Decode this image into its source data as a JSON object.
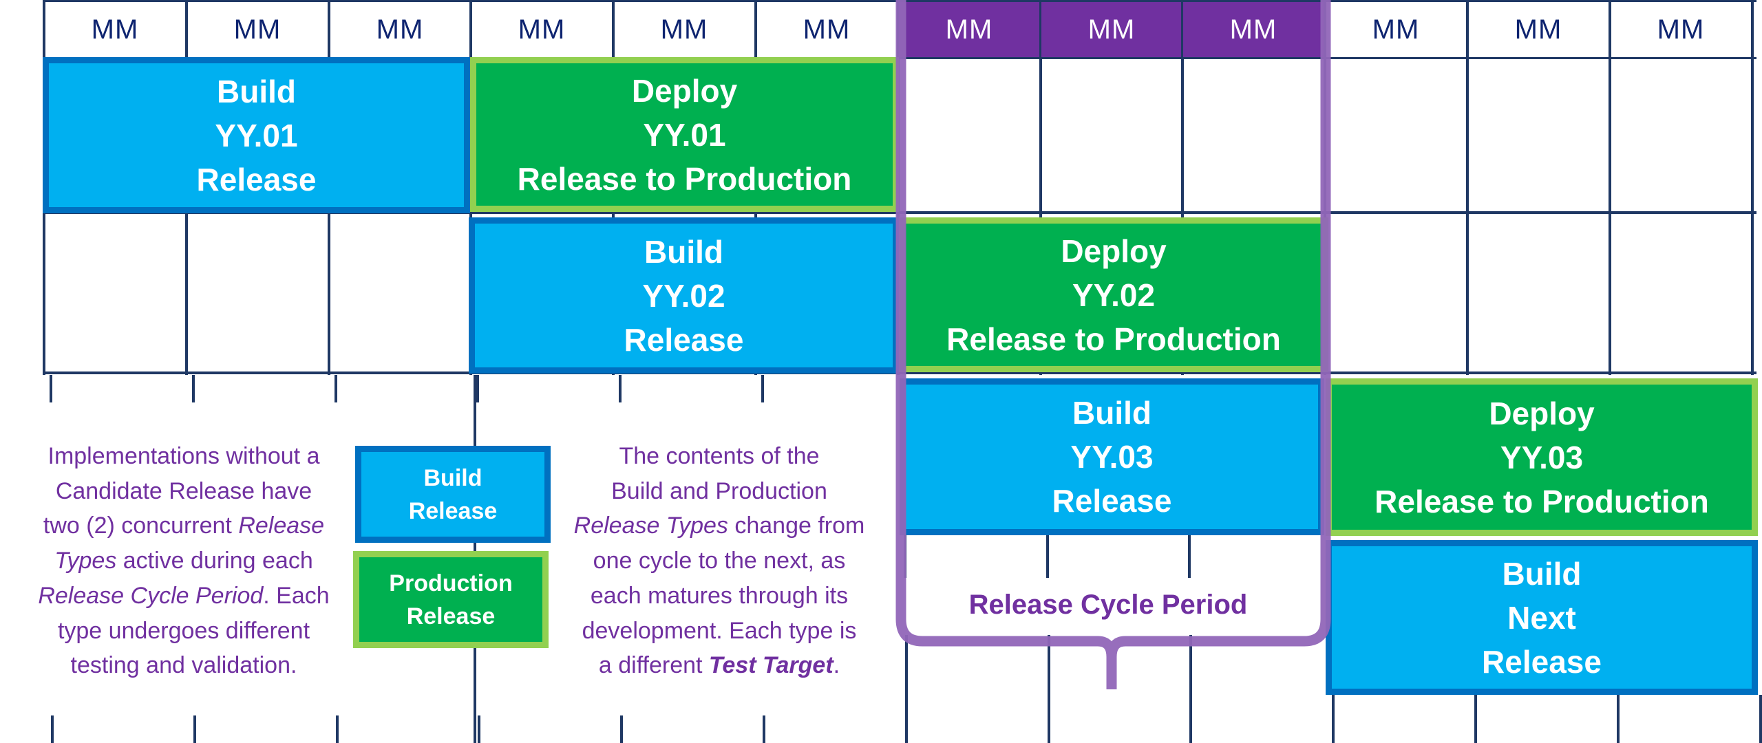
{
  "timeline": {
    "month_headers": [
      "MM",
      "MM",
      "MM",
      "MM",
      "MM",
      "MM",
      "MM",
      "MM",
      "MM",
      "MM",
      "MM",
      "MM"
    ],
    "highlighted_months": [
      6,
      7,
      8
    ]
  },
  "bars": [
    {
      "type": "build",
      "lines": [
        "Build",
        "YY.01",
        "Release"
      ]
    },
    {
      "type": "deploy",
      "lines": [
        "Deploy",
        "YY.01",
        "Release to Production"
      ]
    },
    {
      "type": "build",
      "lines": [
        "Build",
        "YY.02",
        "Release"
      ]
    },
    {
      "type": "deploy",
      "lines": [
        "Deploy",
        "YY.02",
        "Release to Production"
      ]
    },
    {
      "type": "build",
      "lines": [
        "Build",
        "YY.03",
        "Release"
      ]
    },
    {
      "type": "deploy",
      "lines": [
        "Deploy",
        "YY.03",
        "Release to Production"
      ]
    },
    {
      "type": "build",
      "lines": [
        "Build",
        "Next",
        "Release"
      ]
    }
  ],
  "legend": {
    "build": {
      "lines": [
        "Build",
        "Release"
      ]
    },
    "production": {
      "lines": [
        "Production",
        "Release"
      ]
    }
  },
  "bracket": {
    "label": "Release Cycle Period"
  },
  "notes": {
    "left": [
      {
        "t": "Implementations without a"
      },
      {
        "t": "Candidate Release have"
      },
      {
        "t": "two (2) concurrent ",
        "i": "Release"
      },
      {
        "i": "Types",
        "t": " active during each"
      },
      {
        "i": "Release Cycle Period",
        "t": ".  Each"
      },
      {
        "t": "type undergoes different"
      },
      {
        "t": "testing and validation."
      }
    ],
    "right": [
      {
        "t": "The contents of the"
      },
      {
        "t": "Build and Production"
      },
      {
        "i": "Release Types",
        "t": " change from"
      },
      {
        "t": "one cycle to the next, as"
      },
      {
        "t": "each matures through its"
      },
      {
        "t": "development. Each type is"
      },
      {
        "t": "a different ",
        "bi": "Test Target",
        "t2": "."
      }
    ]
  },
  "colors": {
    "build_fill": "#00B0F0",
    "build_border": "#0070C0",
    "deploy_fill": "#00B050",
    "deploy_border": "#92D050",
    "highlight_header": "#7030A0",
    "bracket": "#9166B8",
    "grid": "#1F3864",
    "note_text": "#7030A0"
  }
}
